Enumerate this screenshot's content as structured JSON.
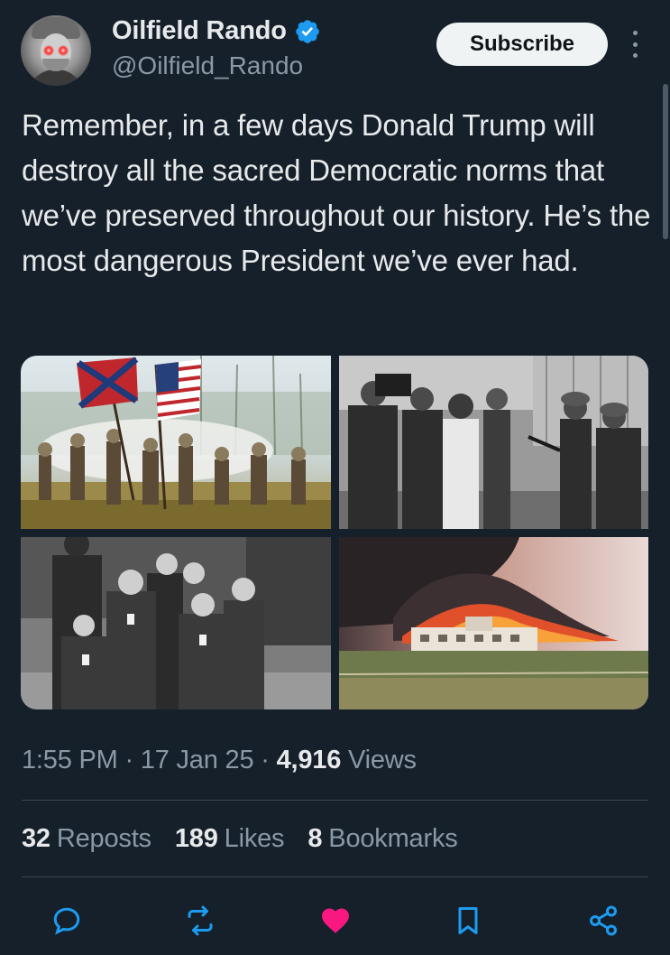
{
  "author": {
    "display_name": "Oilfield Rando",
    "handle": "@Oilfield_Rando",
    "verified": true
  },
  "header": {
    "subscribe_label": "Subscribe",
    "more_icon": "more-vertical-icon"
  },
  "tweet": {
    "text": "Remember, in a few days Donald Trump will destroy all the sacred Democratic norms that we’ve preserved throughout our history. He’s the most dangerous President we’ve ever had.",
    "media": [
      "civil-war-battle-painting",
      "civil-rights-era-soldiers-photo",
      "internment-children-photo",
      "burning-compound-photo"
    ]
  },
  "meta": {
    "time": "1:55 PM",
    "separator": "·",
    "date": "17 Jan 25",
    "views_count": "4,916",
    "views_label": "Views"
  },
  "stats": {
    "reposts_count": "32",
    "reposts_label": "Reposts",
    "likes_count": "189",
    "likes_label": "Likes",
    "bookmarks_count": "8",
    "bookmarks_label": "Bookmarks"
  },
  "actions": {
    "reply_icon": "reply-icon",
    "repost_icon": "repost-icon",
    "like_icon": "heart-icon",
    "bookmark_icon": "bookmark-icon",
    "share_icon": "share-icon"
  },
  "colors": {
    "background": "#15202b",
    "text": "#e7e9ea",
    "muted": "#8b98a5",
    "verified": "#1d9bf0",
    "like": "#f91880",
    "divider": "#38444d"
  }
}
